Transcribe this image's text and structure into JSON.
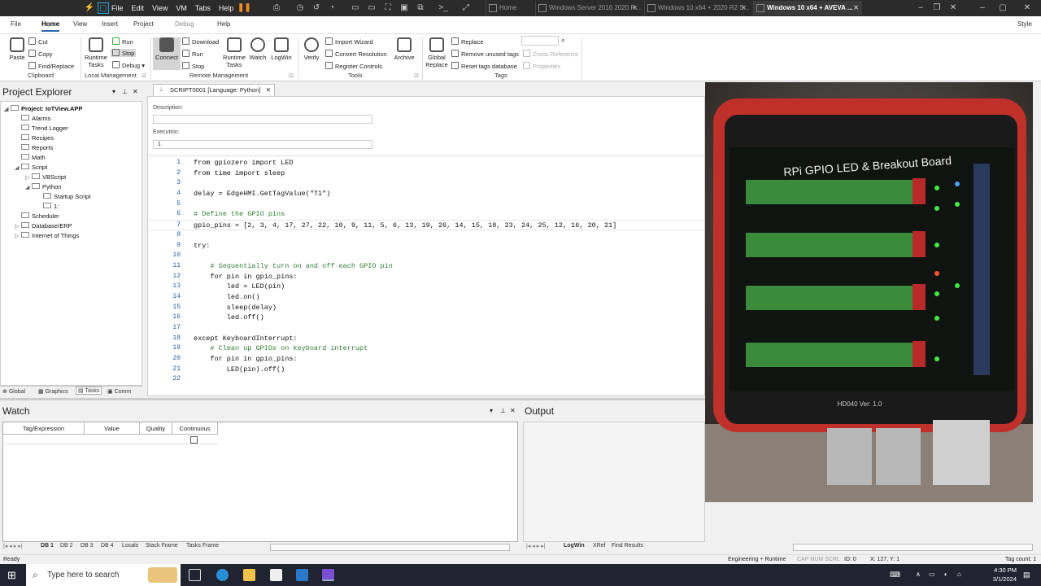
{
  "vm_toolbar": {
    "menu": [
      "File",
      "Edit",
      "View",
      "VM",
      "Tabs",
      "Help"
    ],
    "tabs": [
      {
        "label": "Home",
        "active": false
      },
      {
        "label": "Windows Server 2016 2020 R...",
        "active": false
      },
      {
        "label": "Windows 10 x64 + 2020 R2 S...",
        "active": false
      },
      {
        "label": "Windows 10 x64 + AVEVA ...",
        "active": true
      }
    ]
  },
  "ribbon": {
    "tabs": [
      {
        "label": "File",
        "active": false
      },
      {
        "label": "Home",
        "active": true
      },
      {
        "label": "View",
        "active": false
      },
      {
        "label": "Insert",
        "active": false
      },
      {
        "label": "Project",
        "active": false
      },
      {
        "label": "Debug",
        "active": false
      },
      {
        "label": "Help",
        "active": false
      }
    ],
    "style_label": "Style",
    "clipboard": {
      "paste": "Paste",
      "cut": "Cut",
      "copy": "Copy",
      "find_replace": "Find/Replace",
      "label": "Clipboard"
    },
    "local_mgmt": {
      "runtime_tasks": "Runtime Tasks",
      "run": "Run",
      "stop": "Stop",
      "debug": "Debug",
      "label": "Local Management"
    },
    "remote_mgmt": {
      "connect": "Connect",
      "download": "Download",
      "run": "Run",
      "stop": "Stop",
      "runtime_tasks": "Runtime Tasks",
      "watch": "Watch",
      "logwin": "LogWin",
      "label": "Remote Management"
    },
    "tools": {
      "verify": "Verify",
      "import_wizard": "Import Wizard",
      "convert_resolution": "Convert Resolution",
      "register_controls": "Register Controls",
      "archive": "Archive",
      "label": "Tools"
    },
    "tags": {
      "global_replace": "Global Replace",
      "replace": "Replace",
      "remove_unused": "Remove unused tags",
      "reset_db": "Reset tags database",
      "cross_reference": "Cross Reference",
      "properties": "Properties",
      "label": "Tags"
    }
  },
  "project_explorer": {
    "title": "Project Explorer",
    "tree": {
      "root": "Project: IoTView.APP",
      "alarms": "Alarms",
      "trend_logger": "Trend Logger",
      "recipes": "Recipes",
      "reports": "Reports",
      "math": "Math",
      "script": "Script",
      "vbscript": "VBScript",
      "python": "Python",
      "startup_script": "Startup Script",
      "script_1": "1:",
      "scheduler": "Scheduler",
      "database": "Database/ERP",
      "iot": "Internet of Things"
    },
    "tabs": [
      "Global",
      "Graphics",
      "Tasks",
      "Comm"
    ],
    "active_tab": "Tasks"
  },
  "editor": {
    "tab_label": "SCRIPT0001 [Language: Python]",
    "description_label": "Description:",
    "description_value": "",
    "execution_label": "Execution:",
    "execution_value": "1",
    "lines": [
      {
        "n": "1",
        "t": "from gpiozero import LED"
      },
      {
        "n": "2",
        "t": "from time import sleep"
      },
      {
        "n": "3",
        "t": ""
      },
      {
        "n": "4",
        "t": "delay = EdgeHMI.GetTagValue(\"T1\")"
      },
      {
        "n": "5",
        "t": ""
      },
      {
        "n": "6",
        "t": "# Define the GPIO pins"
      },
      {
        "n": "7",
        "t": "gpio_pins = [2, 3, 4, 17, 27, 22, 10, 9, 11, 5, 6, 13, 19, 26, 14, 15, 18, 23, 24, 25, 12, 16, 20, 21]"
      },
      {
        "n": "8",
        "t": ""
      },
      {
        "n": "9",
        "t": "try:"
      },
      {
        "n": "10",
        "t": ""
      },
      {
        "n": "11",
        "t": "    # Sequentially turn on and off each GPIO pin"
      },
      {
        "n": "12",
        "t": "    for pin in gpio_pins:"
      },
      {
        "n": "13",
        "t": "        led = LED(pin)"
      },
      {
        "n": "14",
        "t": "        led.on()"
      },
      {
        "n": "15",
        "t": "        sleep(delay)"
      },
      {
        "n": "16",
        "t": "        led.off()"
      },
      {
        "n": "17",
        "t": ""
      },
      {
        "n": "18",
        "t": "except KeyboardInterrupt:"
      },
      {
        "n": "19",
        "t": "    # Clean up GPIOs on keyboard interrupt"
      },
      {
        "n": "20",
        "t": "    for pin in gpio_pins:"
      },
      {
        "n": "21",
        "t": "        LED(pin).off()"
      },
      {
        "n": "22",
        "t": ""
      }
    ]
  },
  "watch": {
    "title": "Watch",
    "columns": [
      "Tag/Expression",
      "Value",
      "Quality",
      "Continuous"
    ],
    "tabs": [
      "DB 1",
      "DB 2",
      "DB 3",
      "DB 4",
      "Locals",
      "Stack Frame",
      "Tasks Frame"
    ]
  },
  "output": {
    "title": "Output",
    "tabs": [
      "LogWin",
      "XRef",
      "Find Results"
    ]
  },
  "status_bar": {
    "left": "Ready",
    "mode": "Engineering + Runtime",
    "keys": "CAP NUM SCRL",
    "id": "ID: 0",
    "coords": "X: 127, Y: 1",
    "tag_count": "Tag count: 1"
  },
  "photo": {
    "board_title": "RPi GPIO LED & Breakout Board",
    "board_model": "HD040  Ver: 1.0"
  },
  "taskbar": {
    "search_placeholder": "Type here to search",
    "time": "4:30 PM",
    "date": "3/1/2024"
  }
}
